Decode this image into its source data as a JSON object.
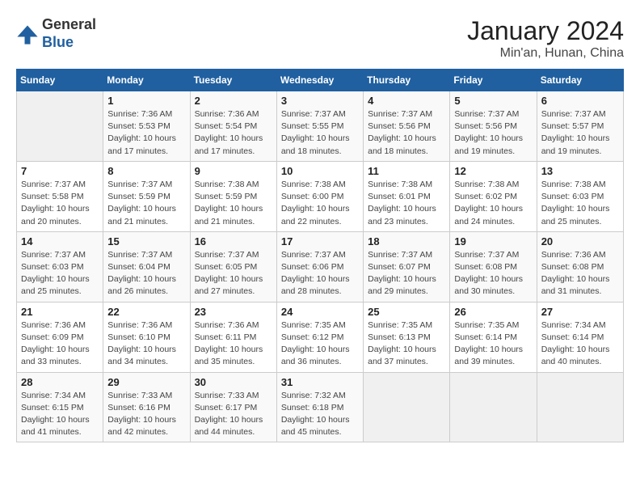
{
  "header": {
    "logo_line1": "General",
    "logo_line2": "Blue",
    "title": "January 2024",
    "subtitle": "Min'an, Hunan, China"
  },
  "days_of_week": [
    "Sunday",
    "Monday",
    "Tuesday",
    "Wednesday",
    "Thursday",
    "Friday",
    "Saturday"
  ],
  "weeks": [
    [
      {
        "num": "",
        "info": ""
      },
      {
        "num": "1",
        "info": "Sunrise: 7:36 AM\nSunset: 5:53 PM\nDaylight: 10 hours\nand 17 minutes."
      },
      {
        "num": "2",
        "info": "Sunrise: 7:36 AM\nSunset: 5:54 PM\nDaylight: 10 hours\nand 17 minutes."
      },
      {
        "num": "3",
        "info": "Sunrise: 7:37 AM\nSunset: 5:55 PM\nDaylight: 10 hours\nand 18 minutes."
      },
      {
        "num": "4",
        "info": "Sunrise: 7:37 AM\nSunset: 5:56 PM\nDaylight: 10 hours\nand 18 minutes."
      },
      {
        "num": "5",
        "info": "Sunrise: 7:37 AM\nSunset: 5:56 PM\nDaylight: 10 hours\nand 19 minutes."
      },
      {
        "num": "6",
        "info": "Sunrise: 7:37 AM\nSunset: 5:57 PM\nDaylight: 10 hours\nand 19 minutes."
      }
    ],
    [
      {
        "num": "7",
        "info": "Sunrise: 7:37 AM\nSunset: 5:58 PM\nDaylight: 10 hours\nand 20 minutes."
      },
      {
        "num": "8",
        "info": "Sunrise: 7:37 AM\nSunset: 5:59 PM\nDaylight: 10 hours\nand 21 minutes."
      },
      {
        "num": "9",
        "info": "Sunrise: 7:38 AM\nSunset: 5:59 PM\nDaylight: 10 hours\nand 21 minutes."
      },
      {
        "num": "10",
        "info": "Sunrise: 7:38 AM\nSunset: 6:00 PM\nDaylight: 10 hours\nand 22 minutes."
      },
      {
        "num": "11",
        "info": "Sunrise: 7:38 AM\nSunset: 6:01 PM\nDaylight: 10 hours\nand 23 minutes."
      },
      {
        "num": "12",
        "info": "Sunrise: 7:38 AM\nSunset: 6:02 PM\nDaylight: 10 hours\nand 24 minutes."
      },
      {
        "num": "13",
        "info": "Sunrise: 7:38 AM\nSunset: 6:03 PM\nDaylight: 10 hours\nand 25 minutes."
      }
    ],
    [
      {
        "num": "14",
        "info": "Sunrise: 7:37 AM\nSunset: 6:03 PM\nDaylight: 10 hours\nand 25 minutes."
      },
      {
        "num": "15",
        "info": "Sunrise: 7:37 AM\nSunset: 6:04 PM\nDaylight: 10 hours\nand 26 minutes."
      },
      {
        "num": "16",
        "info": "Sunrise: 7:37 AM\nSunset: 6:05 PM\nDaylight: 10 hours\nand 27 minutes."
      },
      {
        "num": "17",
        "info": "Sunrise: 7:37 AM\nSunset: 6:06 PM\nDaylight: 10 hours\nand 28 minutes."
      },
      {
        "num": "18",
        "info": "Sunrise: 7:37 AM\nSunset: 6:07 PM\nDaylight: 10 hours\nand 29 minutes."
      },
      {
        "num": "19",
        "info": "Sunrise: 7:37 AM\nSunset: 6:08 PM\nDaylight: 10 hours\nand 30 minutes."
      },
      {
        "num": "20",
        "info": "Sunrise: 7:36 AM\nSunset: 6:08 PM\nDaylight: 10 hours\nand 31 minutes."
      }
    ],
    [
      {
        "num": "21",
        "info": "Sunrise: 7:36 AM\nSunset: 6:09 PM\nDaylight: 10 hours\nand 33 minutes."
      },
      {
        "num": "22",
        "info": "Sunrise: 7:36 AM\nSunset: 6:10 PM\nDaylight: 10 hours\nand 34 minutes."
      },
      {
        "num": "23",
        "info": "Sunrise: 7:36 AM\nSunset: 6:11 PM\nDaylight: 10 hours\nand 35 minutes."
      },
      {
        "num": "24",
        "info": "Sunrise: 7:35 AM\nSunset: 6:12 PM\nDaylight: 10 hours\nand 36 minutes."
      },
      {
        "num": "25",
        "info": "Sunrise: 7:35 AM\nSunset: 6:13 PM\nDaylight: 10 hours\nand 37 minutes."
      },
      {
        "num": "26",
        "info": "Sunrise: 7:35 AM\nSunset: 6:14 PM\nDaylight: 10 hours\nand 39 minutes."
      },
      {
        "num": "27",
        "info": "Sunrise: 7:34 AM\nSunset: 6:14 PM\nDaylight: 10 hours\nand 40 minutes."
      }
    ],
    [
      {
        "num": "28",
        "info": "Sunrise: 7:34 AM\nSunset: 6:15 PM\nDaylight: 10 hours\nand 41 minutes."
      },
      {
        "num": "29",
        "info": "Sunrise: 7:33 AM\nSunset: 6:16 PM\nDaylight: 10 hours\nand 42 minutes."
      },
      {
        "num": "30",
        "info": "Sunrise: 7:33 AM\nSunset: 6:17 PM\nDaylight: 10 hours\nand 44 minutes."
      },
      {
        "num": "31",
        "info": "Sunrise: 7:32 AM\nSunset: 6:18 PM\nDaylight: 10 hours\nand 45 minutes."
      },
      {
        "num": "",
        "info": ""
      },
      {
        "num": "",
        "info": ""
      },
      {
        "num": "",
        "info": ""
      }
    ]
  ]
}
